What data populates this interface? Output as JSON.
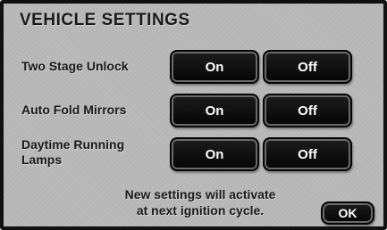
{
  "header": {
    "title": "VEHICLE SETTINGS"
  },
  "settings": [
    {
      "label": "Two Stage Unlock",
      "on_label": "On",
      "off_label": "Off"
    },
    {
      "label": "Auto Fold Mirrors",
      "on_label": "On",
      "off_label": "Off"
    },
    {
      "label_line1": "Daytime Running",
      "label_line2": "Lamps",
      "on_label": "On",
      "off_label": "Off"
    }
  ],
  "notice": {
    "line1": "New settings will activate",
    "line2": "at next ignition cycle."
  },
  "footer": {
    "ok_label": "OK"
  },
  "colors": {
    "background": "#b9b9b9",
    "button": "#0a0a0a",
    "button_text": "#ffffff",
    "frame": "#111111"
  }
}
